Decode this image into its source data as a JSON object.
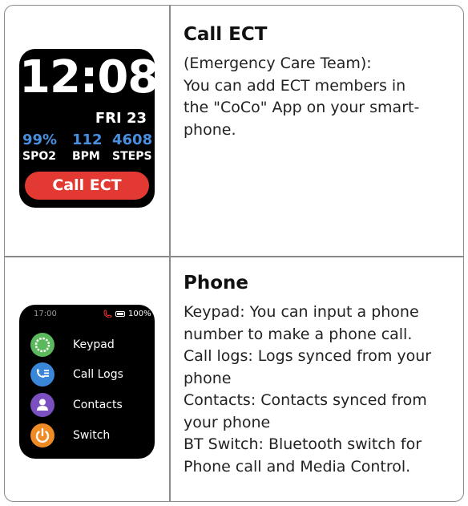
{
  "rows": [
    {
      "title": "Call ECT",
      "description_lines": [
        "(Emergency Care Team):",
        "You can add ECT members in",
        "the \"CoCo\" App on your smart-",
        "phone."
      ],
      "watch": {
        "time": "12:08",
        "date": "FRI 23",
        "stats": [
          {
            "value": "99%",
            "label": "SPO2"
          },
          {
            "value": "112",
            "label": "BPM"
          },
          {
            "value": "4608",
            "label": "STEPS"
          }
        ],
        "button_label": "Call ECT",
        "colors": {
          "stat_value": "#4a8ee0",
          "button": "#e23a33"
        }
      }
    },
    {
      "title": "Phone",
      "description_lines": [
        "Keypad: You can input a phone",
        "number to make a phone call.",
        "Call logs: Logs synced from your",
        "phone",
        "Contacts: Contacts synced from",
        "your phone",
        "BT Switch: Bluetooth switch for",
        "Phone call and Media Control."
      ],
      "watch": {
        "status_time": "17:00",
        "battery": "100%",
        "menu": [
          {
            "label": "Keypad",
            "icon": "keypad-icon",
            "color": "#5cb85c"
          },
          {
            "label": "Call Logs",
            "icon": "call-logs-icon",
            "color": "#3a86d8"
          },
          {
            "label": "Contacts",
            "icon": "contacts-icon",
            "color": "#7a4fc0"
          },
          {
            "label": "Switch",
            "icon": "power-switch-icon",
            "color": "#f08a24"
          }
        ]
      }
    }
  ]
}
